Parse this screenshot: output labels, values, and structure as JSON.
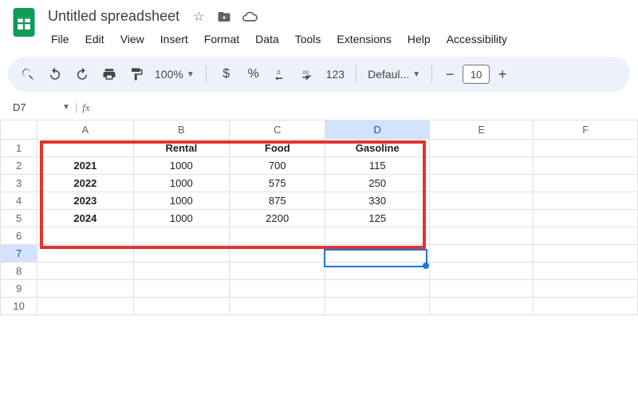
{
  "doc": {
    "title": "Untitled spreadsheet"
  },
  "menu": {
    "file": "File",
    "edit": "Edit",
    "view": "View",
    "insert": "Insert",
    "format": "Format",
    "data": "Data",
    "tools": "Tools",
    "extensions": "Extensions",
    "help": "Help",
    "accessibility": "Accessibility"
  },
  "toolbar": {
    "zoom": "100%",
    "currency": "$",
    "percent": "%",
    "dec_dec": ".0",
    "dec_inc": ".00",
    "numfmt": "123",
    "font": "Defaul...",
    "font_size": "10"
  },
  "name_box": "D7",
  "fx_label": "fx",
  "columns": [
    "A",
    "B",
    "C",
    "D",
    "E",
    "F"
  ],
  "rows": [
    "1",
    "2",
    "3",
    "4",
    "5",
    "6",
    "7",
    "8",
    "9",
    "10"
  ],
  "selected_col": "D",
  "selected_row": "7",
  "chart_data": {
    "type": "table",
    "title": "",
    "headers": [
      "",
      "Rental",
      "Food",
      "Gasoline"
    ],
    "rows": [
      {
        "year": "2021",
        "rental": 1000,
        "food": 700,
        "gasoline": 115
      },
      {
        "year": "2022",
        "rental": 1000,
        "food": 575,
        "gasoline": 250
      },
      {
        "year": "2023",
        "rental": 1000,
        "food": 875,
        "gasoline": 330
      },
      {
        "year": "2024",
        "rental": 1000,
        "food": 2200,
        "gasoline": 125
      }
    ]
  },
  "cells": {
    "B1": "Rental",
    "C1": "Food",
    "D1": "Gasoline",
    "A2": "2021",
    "B2": "1000",
    "C2": "700",
    "D2": "115",
    "A3": "2022",
    "B3": "1000",
    "C3": "575",
    "D3": "250",
    "A4": "2023",
    "B4": "1000",
    "C4": "875",
    "D4": "330",
    "A5": "2024",
    "B5": "1000",
    "C5": "2200",
    "D5": "125"
  }
}
